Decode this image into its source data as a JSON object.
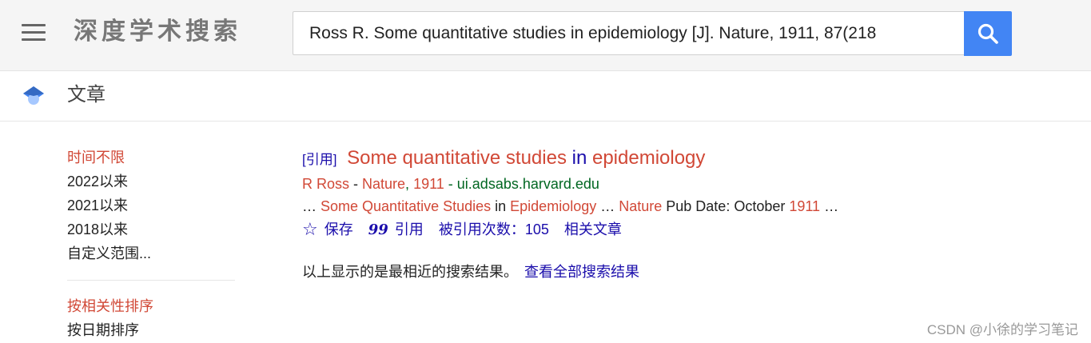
{
  "header": {
    "logo": "深度学术搜索",
    "search_value": "Ross R. Some quantitative studies in epidemiology [J]. Nature, 1911, 87(218",
    "icons": {
      "menu": "hamburger-menu-icon",
      "search": "search-icon"
    }
  },
  "section": {
    "title": "文章",
    "icon": "graduation-cap-icon"
  },
  "sidebar": {
    "time_filters": [
      "时间不限",
      "2022以来",
      "2021以来",
      "2018以来",
      "自定义范围..."
    ],
    "sort_options": [
      "按相关性排序",
      "按日期排序"
    ]
  },
  "result": {
    "tag": "[引用]",
    "title_part1": "Some quantitative studies",
    "title_part2": "in",
    "title_part3": "epidemiology",
    "author": "R Ross",
    "sep1": " - ",
    "journal": "Nature",
    "comma": ", ",
    "year": "1911",
    "sep2": " - ",
    "source": "ui.adsabs.harvard.edu",
    "snippet_1": "… ",
    "snippet_2": "Some Quantitative Studies",
    "snippet_3": " in ",
    "snippet_4": "Epidemiology",
    "snippet_5": " … ",
    "snippet_6": "Nature",
    "snippet_7": " Pub Date: October ",
    "snippet_8": "1911",
    "snippet_9": " …",
    "actions": {
      "save": "保存",
      "cite": "引用",
      "cited_by": "被引用次数：105",
      "related": "相关文章"
    }
  },
  "footer_note": {
    "text": "以上显示的是最相近的搜索结果。",
    "link": "查看全部搜索结果"
  },
  "watermark": "CSDN @小徐的学习笔记",
  "colors": {
    "accent": "#4285f4",
    "highlight": "#d14836",
    "link": "#1a0dab",
    "url": "#006621"
  }
}
